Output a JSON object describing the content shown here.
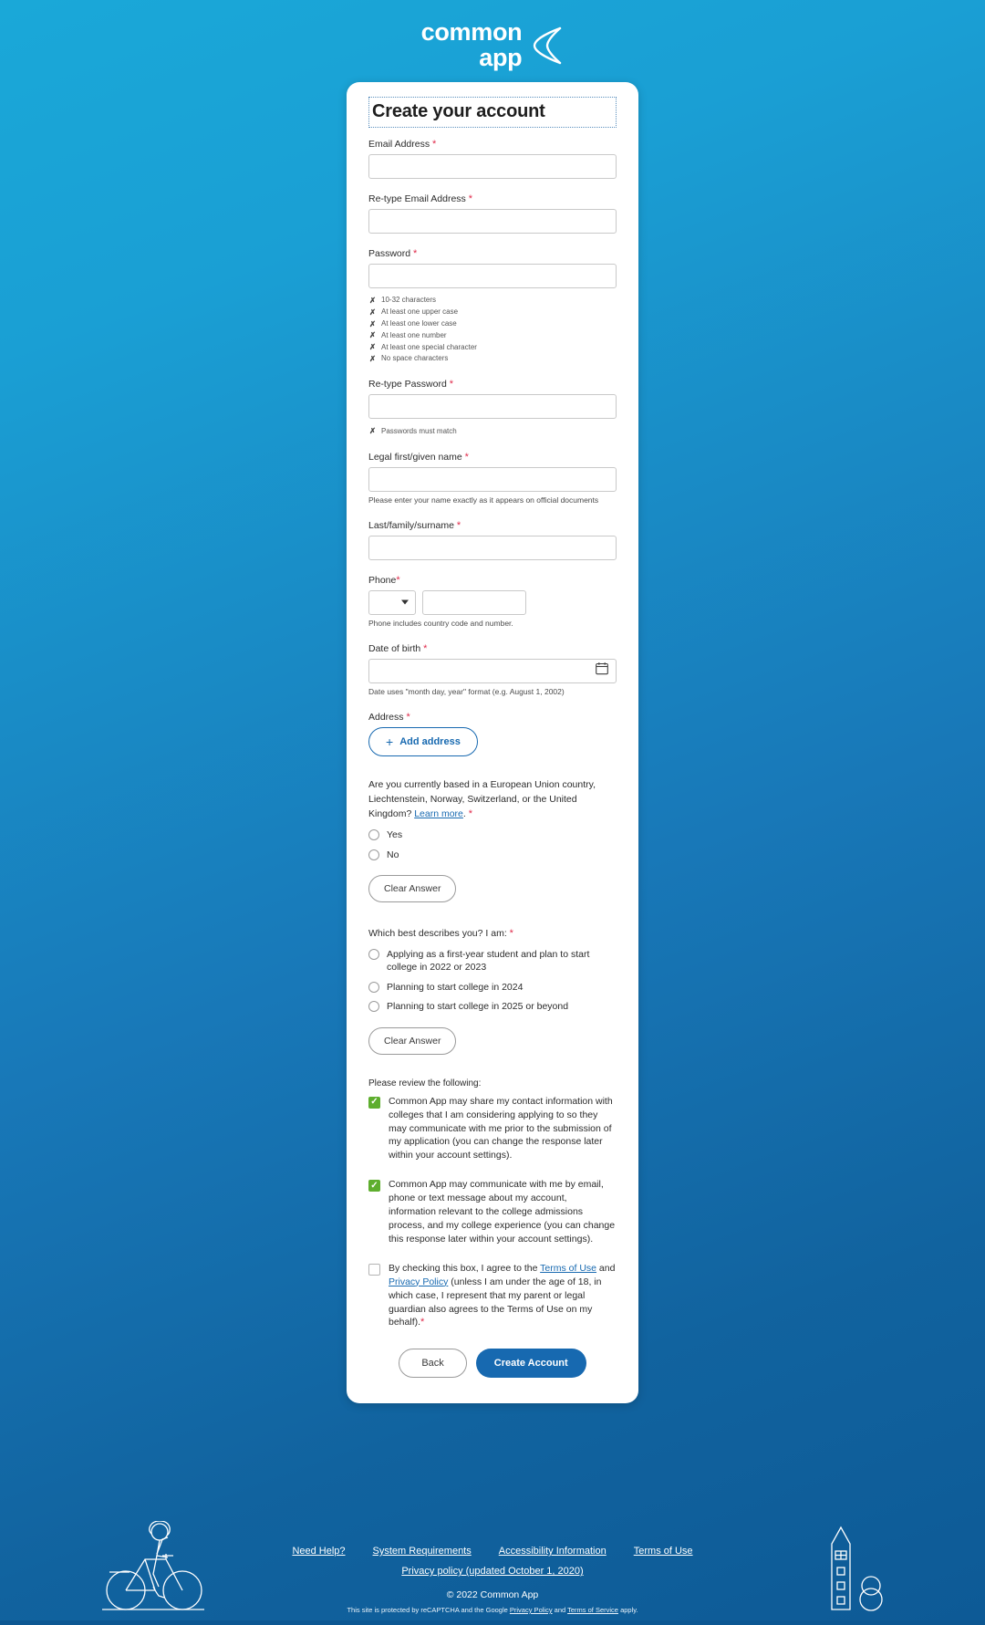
{
  "brand": {
    "logo_line1": "common",
    "logo_line2": "app",
    "accent_blue": "#1769b0",
    "header_cyan": "#1aa8d8",
    "check_green": "#5eae2e",
    "required_red": "#e02b4b"
  },
  "form": {
    "title": "Create your account",
    "email": {
      "label": "Email Address",
      "value": "",
      "placeholder": ""
    },
    "email_retype": {
      "label": "Re-type Email Address",
      "value": "",
      "placeholder": ""
    },
    "password": {
      "label": "Password",
      "value": "",
      "placeholder": ""
    },
    "password_rules": [
      "10-32 characters",
      "At least one upper case",
      "At least one lower case",
      "At least one number",
      "At least one special character",
      "No space characters"
    ],
    "password_retype": {
      "label": "Re-type Password",
      "value": "",
      "rule": "Passwords must match"
    },
    "first_name": {
      "label": "Legal first/given name",
      "value": "",
      "help": "Please enter your name exactly as it appears on official documents"
    },
    "last_name": {
      "label": "Last/family/surname",
      "value": ""
    },
    "phone": {
      "label": "Phone",
      "country_value": "",
      "number_value": "",
      "help": "Phone includes country code and number."
    },
    "dob": {
      "label": "Date of birth",
      "value": "",
      "help": "Date uses \"month day, year\" format (e.g. August 1, 2002)"
    },
    "address": {
      "label": "Address",
      "add_button": "Add address",
      "plus_glyph": "+"
    },
    "eu_question": {
      "text_part1": "Are you currently based in a European Union country, Liechtenstein, Norway, Switzerland, or the United Kingdom? ",
      "link": "Learn more",
      "text_part2": ".",
      "options": [
        "Yes",
        "No"
      ],
      "clear_button": "Clear Answer"
    },
    "describe_question": {
      "text": "Which best describes you? I am:",
      "options": [
        "Applying as a first-year student and plan to start college in 2022 or 2023",
        "Planning to start college in 2024",
        "Planning to start college in 2025 or beyond"
      ],
      "clear_button": "Clear Answer"
    },
    "consent": {
      "intro": "Please review the following:",
      "item1": {
        "checked": true,
        "text": "Common App may share my contact information with colleges that I am considering applying to so they may communicate with me prior to the submission of my application (you can change the response later within your account settings)."
      },
      "item2": {
        "checked": true,
        "text": "Common App may communicate with me by email, phone or text message about my account, information relevant to the college admissions process, and my college experience (you can change this response later within your account settings)."
      },
      "item3": {
        "checked": false,
        "text_part1": "By checking this box, I agree to the ",
        "link1": "Terms of Use",
        "text_part2": " and ",
        "link2": "Privacy Policy",
        "text_part3": " (unless I am under the age of 18, in which case, I represent that my parent or legal guardian also agrees to the Terms of Use on my behalf)."
      }
    },
    "actions": {
      "back": "Back",
      "submit": "Create Account"
    }
  },
  "footer": {
    "links_row1": [
      "Need Help?",
      "System Requirements",
      "Accessibility Information",
      "Terms of Use"
    ],
    "privacy_link": "Privacy policy (updated October 1, 2020)",
    "copyright": "© 2022 Common App",
    "recaptcha_part1": "This site is protected by reCAPTCHA and the Google ",
    "recaptcha_link1": "Privacy Policy",
    "recaptcha_and": " and ",
    "recaptcha_link2": "Terms of Service",
    "recaptcha_part2": " apply."
  }
}
